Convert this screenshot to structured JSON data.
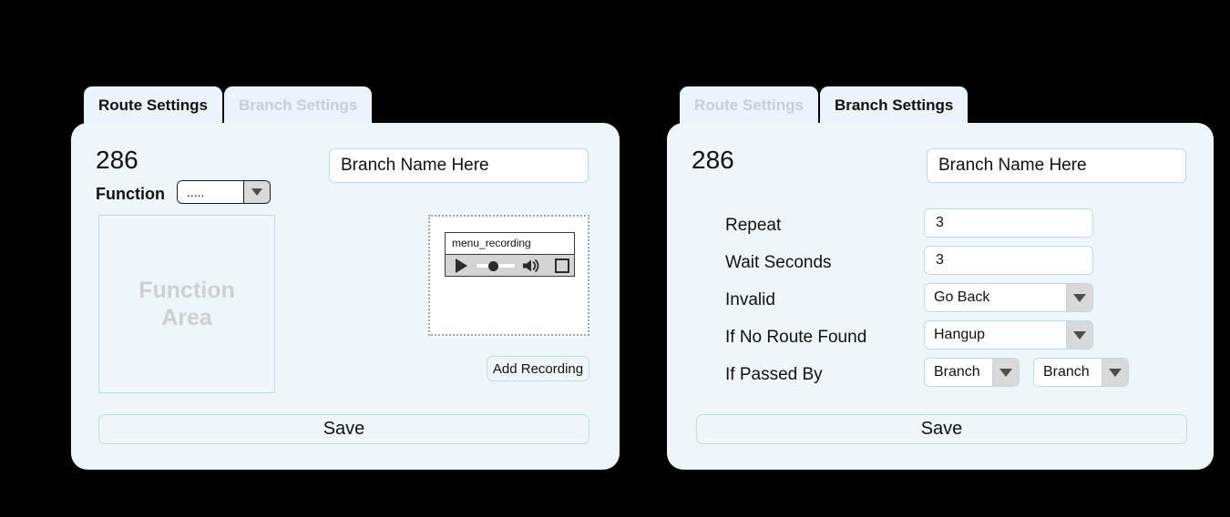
{
  "left_panel": {
    "tabs": [
      {
        "label": "Route Settings",
        "active": true
      },
      {
        "label": "Branch Settings",
        "active": false
      }
    ],
    "route_id": "286",
    "branch_name": {
      "value": "Branch Name Here"
    },
    "function": {
      "label": "Function",
      "value": ".....",
      "arrow_icon": "chevron-down-icon"
    },
    "function_area": {
      "line1": "Function",
      "line2": "Area"
    },
    "recording": {
      "player_title": "menu_recording",
      "play_icon": "play-icon",
      "volume_icon": "volume-icon",
      "fullscreen_icon": "fullscreen-icon",
      "slider_icon": "progress-slider"
    },
    "add_recording_label": "Add Recording",
    "save_label": "Save"
  },
  "right_panel": {
    "tabs": [
      {
        "label": "Route Settings",
        "active": false
      },
      {
        "label": "Branch Settings",
        "active": true
      }
    ],
    "route_id": "286",
    "branch_name": {
      "value": "Branch Name Here"
    },
    "fields": [
      {
        "label": "Repeat",
        "type": "text",
        "value": "3"
      },
      {
        "label": "Wait Seconds",
        "type": "text",
        "value": "3"
      },
      {
        "label": "Invalid",
        "type": "select",
        "value": "Go Back"
      },
      {
        "label": "If No Route Found",
        "type": "select",
        "value": "Hangup"
      },
      {
        "label": "If Passed By",
        "type": "select-pair",
        "value": "Branch",
        "value2": "Branch"
      }
    ],
    "save_label": "Save"
  },
  "colors": {
    "panel_bg": "#eef6fa",
    "tab_bg": "#eaf4fa",
    "border_light": "#bdd9e6",
    "inactive_tab_text": "#c3cfd6",
    "placeholder_text": "#cfcfcf",
    "page_bg": "#000000"
  }
}
